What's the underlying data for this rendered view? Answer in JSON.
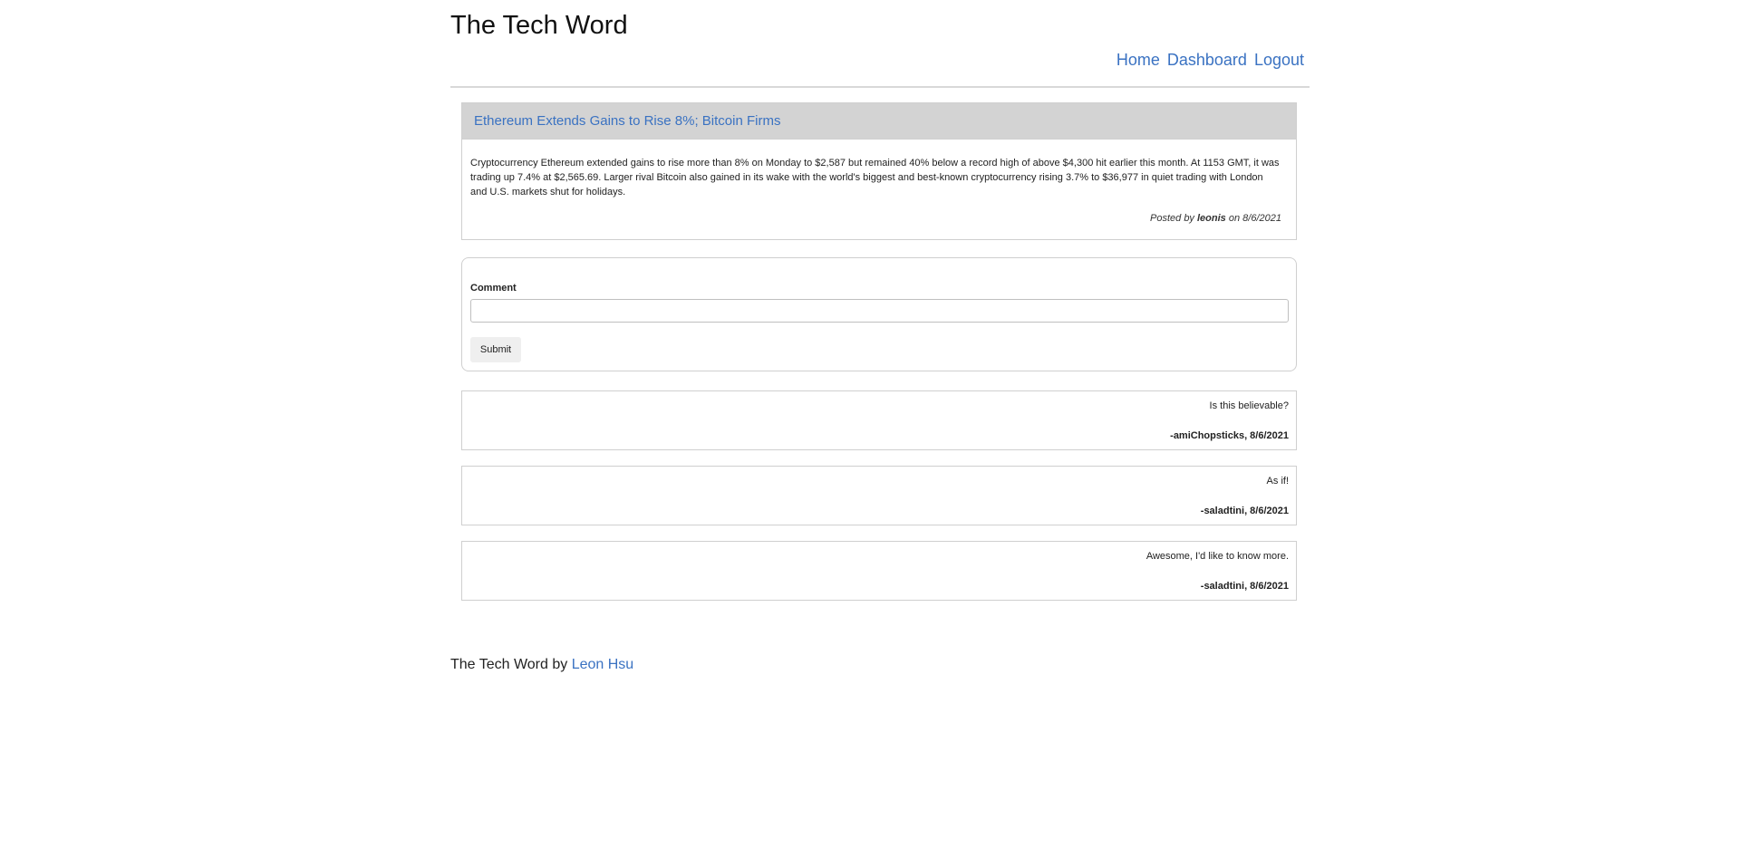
{
  "header": {
    "title": "The Tech Word",
    "nav": [
      {
        "label": "Home"
      },
      {
        "label": "Dashboard"
      },
      {
        "label": "Logout"
      }
    ]
  },
  "post": {
    "title": "Ethereum Extends Gains to Rise 8%; Bitcoin Firms",
    "body": "Cryptocurrency Ethereum extended gains to rise more than 8% on Monday to $2,587 but remained 40% below a record high of above $4,300 hit earlier this month. At 1153 GMT, it was trading up 7.4% at $2,565.69. Larger rival Bitcoin also gained in its wake with the world's biggest and best-known cryptocurrency rising 3.7% to $36,977 in quiet trading with London and U.S. markets shut for holidays.",
    "posted_by_prefix": "Posted by",
    "author": "leonis",
    "on_word": "on",
    "date": "8/6/2021"
  },
  "comment_form": {
    "label": "Comment",
    "value": "",
    "placeholder": "",
    "submit_label": "Submit"
  },
  "comments": [
    {
      "text": "Is this believable?",
      "meta": "-amiChopsticks, 8/6/2021"
    },
    {
      "text": "As if!",
      "meta": "-saladtini, 8/6/2021"
    },
    {
      "text": "Awesome, I'd like to know more.",
      "meta": "-saladtini, 8/6/2021"
    }
  ],
  "footer": {
    "text": "The Tech Word by",
    "link_label": "Leon Hsu"
  }
}
